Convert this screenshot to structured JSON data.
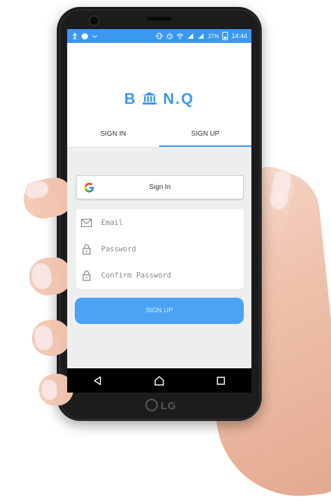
{
  "device": {
    "brand": "LG"
  },
  "statusbar": {
    "battery": "27%",
    "time": "14:44"
  },
  "app": {
    "brand": "B N.Q",
    "brand_left": "B",
    "brand_right": "N.Q"
  },
  "tabs": [
    {
      "label": "SIGN IN",
      "active": false
    },
    {
      "label": "SIGN UP",
      "active": true
    }
  ],
  "google": {
    "label": "Sign In"
  },
  "form": {
    "email_placeholder": "Email",
    "password_placeholder": "Password",
    "confirm_placeholder": "Confirm Password"
  },
  "signup_button": {
    "label": "SIGN UP"
  },
  "colors": {
    "accent": "#3b98f0",
    "button": "#4ba3f5",
    "background": "#eeeeee"
  },
  "icons": [
    "back-icon",
    "home-icon",
    "recents-icon",
    "mail-icon",
    "lock-icon",
    "google-logo-icon",
    "bank-icon"
  ]
}
